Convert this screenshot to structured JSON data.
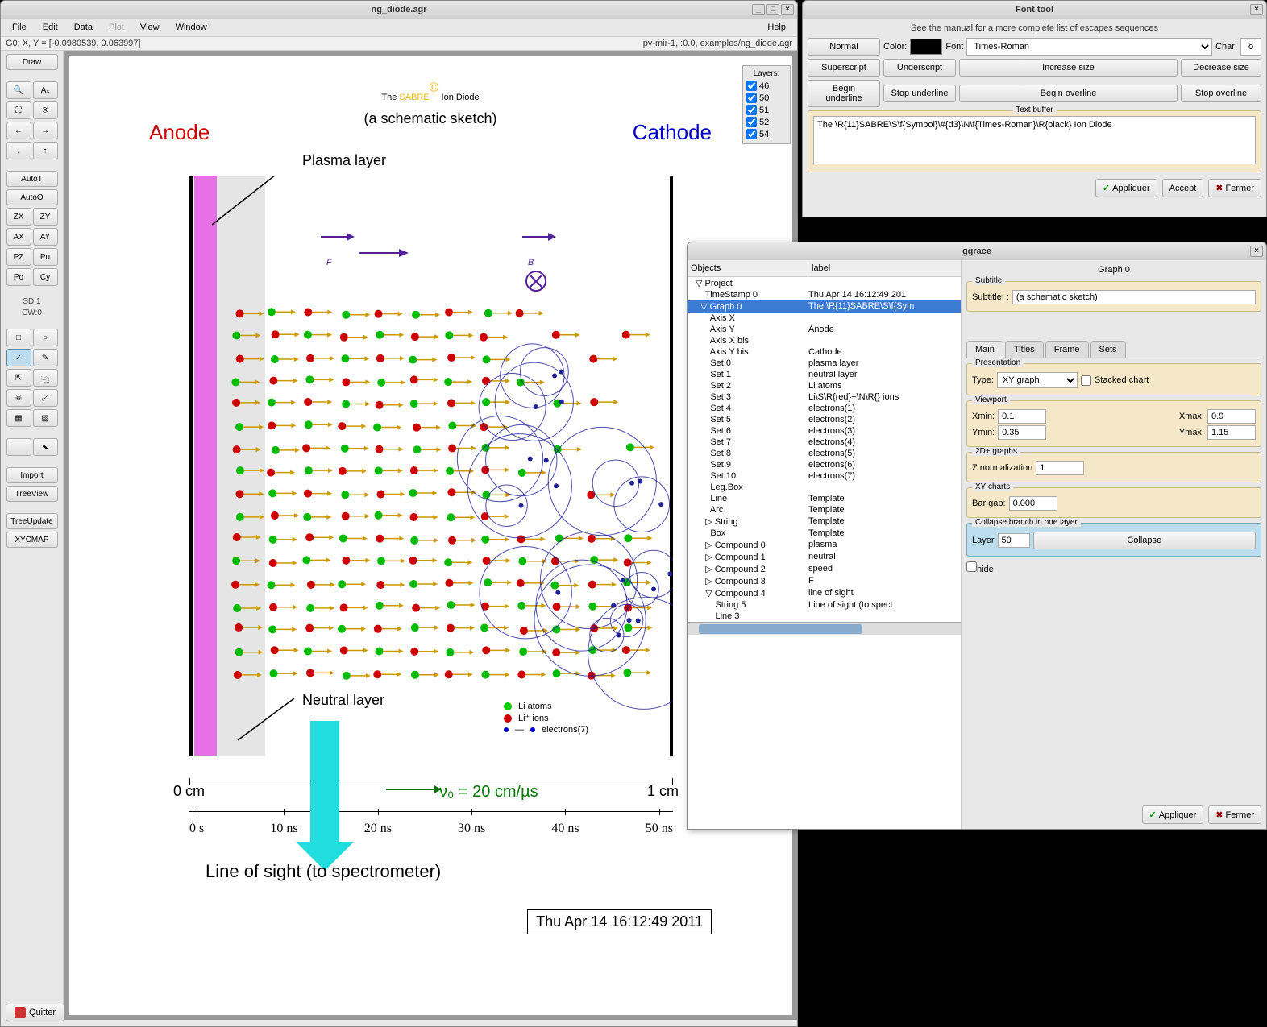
{
  "main_window": {
    "title": "ng_diode.agr",
    "menubar": [
      "File",
      "Edit",
      "Data",
      "Plot",
      "View",
      "Window",
      "Help"
    ],
    "menubar_disabled": "Plot",
    "status_left": "G0: X, Y = [-0.0980539, 0.063997]",
    "status_right": "pv-mir-1, :0.0, examples/ng_diode.agr",
    "layers": {
      "title": "Layers:",
      "items": [
        "46",
        "50",
        "51",
        "52",
        "54"
      ]
    },
    "toolbar": {
      "draw": "Draw",
      "autot": "AutoT",
      "autoo": "AutoO",
      "pairs": [
        [
          "ZX",
          "ZY"
        ],
        [
          "AX",
          "AY"
        ],
        [
          "PZ",
          "Pu"
        ],
        [
          "Po",
          "Cy"
        ]
      ],
      "sd": "SD:1",
      "cw": "CW:0",
      "import": "Import",
      "treeview": "TreeView",
      "treeupdate": "TreeUpdate",
      "xycmap": "XYCMAP"
    },
    "quitter": "Quitter"
  },
  "diagram": {
    "title_pre": "The ",
    "title_sabre": "SABRE",
    "title_copy": "©",
    "title_post": " Ion Diode",
    "subtitle": "(a schematic sketch)",
    "anode": "Anode",
    "cathode": "Cathode",
    "plasma_layer": "Plasma layer",
    "neutral_layer": "Neutral layer",
    "F": "F",
    "B": "B",
    "cm0": "0 cm",
    "cm1": "1 cm",
    "time_ticks": [
      "0 s",
      "10 ns",
      "20 ns",
      "30 ns",
      "40 ns",
      "50 ns"
    ],
    "v0": "ν₀ = 20 cm/µs",
    "los": "Line of sight (to spectrometer)",
    "legend": {
      "li_atoms": "Li atoms",
      "li_ions": "Li⁺ ions",
      "electrons": "electrons(7)"
    },
    "timestamp": "Thu Apr 14 16:12:49 2011"
  },
  "font_tool": {
    "title": "Font tool",
    "hint": "See the manual for a more complete list of escapes sequences",
    "normal": "Normal",
    "color_lbl": "Color:",
    "font_lbl": "Font",
    "font_value": "Times-Roman",
    "char_lbl": "Char:",
    "char_value": "ô",
    "superscript": "Superscript",
    "underscript": "Underscript",
    "increase": "Increase size",
    "decrease": "Decrease size",
    "begin_u": "Begin underline",
    "stop_u": "Stop underline",
    "begin_o": "Begin overline",
    "stop_o": "Stop overline",
    "textbuf_lbl": "Text buffer",
    "textbuf_value": "The \\R{11}SABRE\\S\\f{Symbol}\\#{d3}\\N\\f{Times-Roman}\\R{black} Ion Diode",
    "apply": "Appliquer",
    "accept": "Accept",
    "close": "Fermer"
  },
  "ggrace": {
    "title": "ggrace",
    "cols": {
      "objects": "Objects",
      "label": "label"
    },
    "graph_title": "Graph 0",
    "tree": [
      {
        "d": 0,
        "arr": "▽",
        "name": "Project",
        "label": ""
      },
      {
        "d": 1,
        "arr": "",
        "name": "TimeStamp 0",
        "label": "Thu Apr 14 16:12:49 201"
      },
      {
        "d": 1,
        "arr": "▽",
        "name": "Graph 0",
        "label": "The \\R{11}SABRE\\S\\f{Sym",
        "sel": true
      },
      {
        "d": 2,
        "arr": "",
        "name": "Axis X",
        "label": ""
      },
      {
        "d": 2,
        "arr": "",
        "name": "Axis Y",
        "label": "Anode"
      },
      {
        "d": 2,
        "arr": "",
        "name": "Axis X bis",
        "label": ""
      },
      {
        "d": 2,
        "arr": "",
        "name": "Axis Y bis",
        "label": "Cathode"
      },
      {
        "d": 2,
        "arr": "",
        "name": "Set 0",
        "label": "plasma layer"
      },
      {
        "d": 2,
        "arr": "",
        "name": "Set 1",
        "label": "neutral layer"
      },
      {
        "d": 2,
        "arr": "",
        "name": "Set 2",
        "label": "Li atoms"
      },
      {
        "d": 2,
        "arr": "",
        "name": "Set 3",
        "label": "Li\\S\\R{red}+\\N\\R{} ions"
      },
      {
        "d": 2,
        "arr": "",
        "name": "Set 4",
        "label": "electrons(1)"
      },
      {
        "d": 2,
        "arr": "",
        "name": "Set 5",
        "label": "electrons(2)"
      },
      {
        "d": 2,
        "arr": "",
        "name": "Set 6",
        "label": "electrons(3)"
      },
      {
        "d": 2,
        "arr": "",
        "name": "Set 7",
        "label": "electrons(4)"
      },
      {
        "d": 2,
        "arr": "",
        "name": "Set 8",
        "label": "electrons(5)"
      },
      {
        "d": 2,
        "arr": "",
        "name": "Set 9",
        "label": "electrons(6)"
      },
      {
        "d": 2,
        "arr": "",
        "name": "Set 10",
        "label": "electrons(7)"
      },
      {
        "d": 2,
        "arr": "",
        "name": "Leg.Box",
        "label": ""
      },
      {
        "d": 2,
        "arr": "",
        "name": "Line",
        "label": "Template"
      },
      {
        "d": 2,
        "arr": "",
        "name": "Arc",
        "label": "Template"
      },
      {
        "d": 2,
        "arr": "▷",
        "name": "String",
        "label": "Template"
      },
      {
        "d": 2,
        "arr": "",
        "name": "Box",
        "label": "Template"
      },
      {
        "d": 2,
        "arr": "▷",
        "name": "Compound 0",
        "label": "plasma"
      },
      {
        "d": 2,
        "arr": "▷",
        "name": "Compound 1",
        "label": "neutral"
      },
      {
        "d": 2,
        "arr": "▷",
        "name": "Compound 2",
        "label": "speed"
      },
      {
        "d": 2,
        "arr": "▷",
        "name": "Compound 3",
        "label": "F"
      },
      {
        "d": 2,
        "arr": "▽",
        "name": "Compound 4",
        "label": "line of sight"
      },
      {
        "d": 3,
        "arr": "",
        "name": "String 5",
        "label": "Line of sight (to spect"
      },
      {
        "d": 3,
        "arr": "",
        "name": "Line 3",
        "label": ""
      }
    ],
    "subtitle_lbl": "Subtitle",
    "subtitle_field": "Subtitle: :",
    "subtitle_value": "(a schematic sketch)",
    "tabs": [
      "Main",
      "Titles",
      "Frame",
      "Sets"
    ],
    "presentation_lbl": "Presentation",
    "type_lbl": "Type:",
    "type_value": "XY graph",
    "stacked_lbl": "Stacked chart",
    "viewport_lbl": "Viewport",
    "xmin_lbl": "Xmin:",
    "xmin_val": "0.1",
    "xmax_lbl": "Xmax:",
    "xmax_val": "0.9",
    "ymin_lbl": "Ymin:",
    "ymin_val": "0.35",
    "ymax_lbl": "Ymax:",
    "ymax_val": "1.15",
    "z2d_lbl": "2D+ graphs",
    "znorm_lbl": "Z normalization",
    "znorm_val": "1",
    "xy_lbl": "XY charts",
    "bargap_lbl": "Bar gap:",
    "bargap_val": "0.000",
    "collapse_lbl": "Collapse branch in one layer",
    "layer_lbl": "Layer",
    "layer_val": "50",
    "collapse_btn": "Collapse",
    "hide_lbl": "hide",
    "apply": "Appliquer",
    "close": "Fermer"
  }
}
